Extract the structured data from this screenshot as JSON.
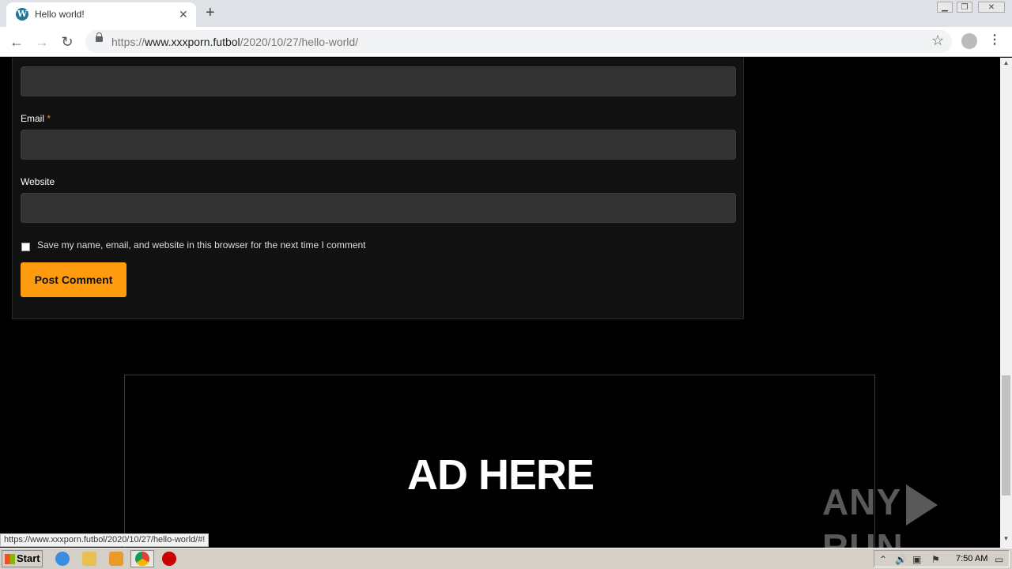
{
  "browser": {
    "tab_title": "Hello world!",
    "url_scheme": "https://",
    "url_host": "www.xxxporn.futbol",
    "url_path": "/2020/10/27/hello-world/",
    "status_url": "https://www.xxxporn.futbol/2020/10/27/hello-world/#!"
  },
  "form": {
    "email_label": "Email",
    "required_mark": "*",
    "website_label": "Website",
    "save_checkbox_label": "Save my name, email, and website in this browser for the next time I comment",
    "submit_label": "Post Comment",
    "name_value": "",
    "email_value": "",
    "website_value": ""
  },
  "ad": {
    "text": "AD HERE"
  },
  "watermark": {
    "left": "ANY",
    "right": "RUN"
  },
  "taskbar": {
    "start_label": "Start",
    "clock": "7:50 AM"
  },
  "colors": {
    "accent_button": "#ff9b0f",
    "page_background": "#000000",
    "form_background": "#111111",
    "input_background": "#333333"
  }
}
